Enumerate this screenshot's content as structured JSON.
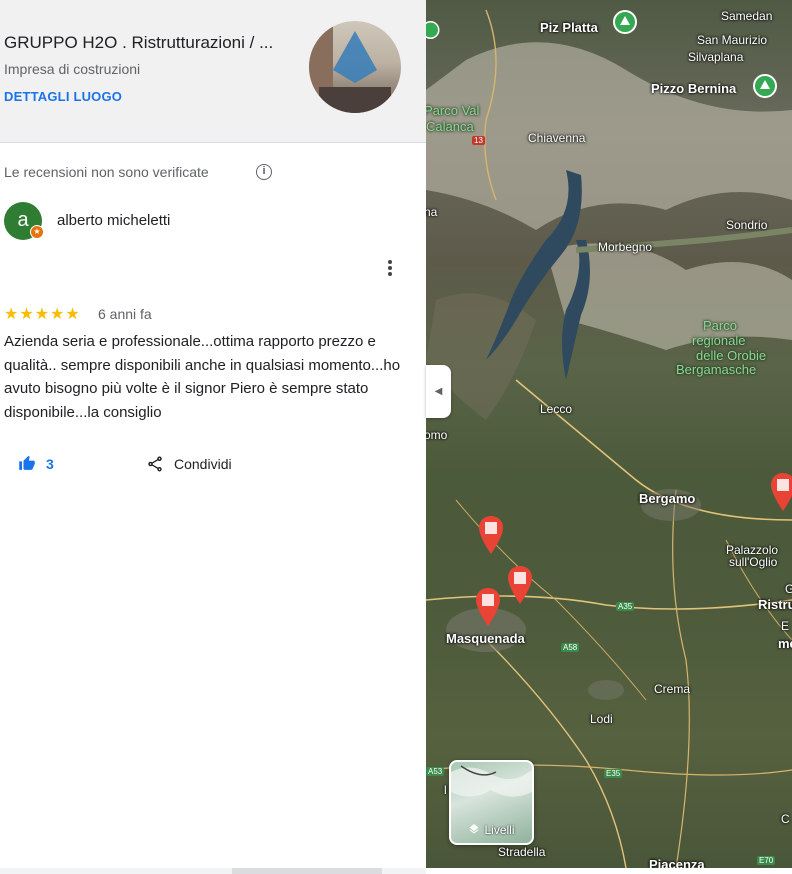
{
  "place": {
    "title": "GRUPPO H2O . Ristrutturazioni / ...",
    "category": "Impresa di costruzioni",
    "details_link": "DETTAGLI LUOGO"
  },
  "reviews": {
    "disclaimer": "Le recensioni non sono verificate",
    "info_icon": "info-icon",
    "review": {
      "avatar_letter": "a",
      "reviewer_name": "alberto micheletti",
      "rating": 5,
      "stars": "★★★★★",
      "time_ago": "6 anni fa",
      "text": "Azienda seria e professionale...ottima rapporto prezzo e qualità.. sempre disponibili anche in qualsiasi momento...ho avuto bisogno più volte è il signor Piero è sempre stato disponibile...la consiglio",
      "likes": "3",
      "share_label": "Condividi"
    }
  },
  "map": {
    "labels": {
      "samedan": "Samedan",
      "piz_platta": "Piz Platta",
      "san_maurizio": "San Maurizio",
      "silvaplana": "Silvaplana",
      "pizzo_bernina": "Pizzo Bernina",
      "parco_val": "Parco Val",
      "calanca": "Calanca",
      "chiavenna": "Chiavenna",
      "sondrio": "Sondrio",
      "morbegno": "Morbegno",
      "parco_orobie_1": "Parco",
      "parco_orobie_2": "regionale",
      "parco_orobie_3": "delle Orobie",
      "parco_orobie_4": "Bergamasche",
      "lecco": "Lecco",
      "omo": "omo",
      "na": "na",
      "bergamo": "Bergamo",
      "palazzolo_1": "Palazzolo",
      "palazzolo_2": "sull'Oglio",
      "ristru": "Ristru",
      "g": "G",
      "e": "E",
      "me": "me",
      "masquenada": "Masquenada",
      "crema": "Crema",
      "lodi": "Lodi",
      "stradella": "Stradella",
      "piacenza": "Piacenza",
      "c": "C",
      "l": "l"
    },
    "road_shields": {
      "r13": "13",
      "a35": "A35",
      "a58": "A58",
      "a53": "A53",
      "e35": "E35",
      "e70": "E70"
    },
    "layers_label": "Livelli",
    "collapse_icon": "chevron-left-icon"
  },
  "colors": {
    "accent": "#1a73e8",
    "avatar_bg": "#2e7d32",
    "badge": "#e8710a",
    "star": "#fbbc04",
    "marker": "#e84335",
    "park_marker": "#34a853"
  }
}
